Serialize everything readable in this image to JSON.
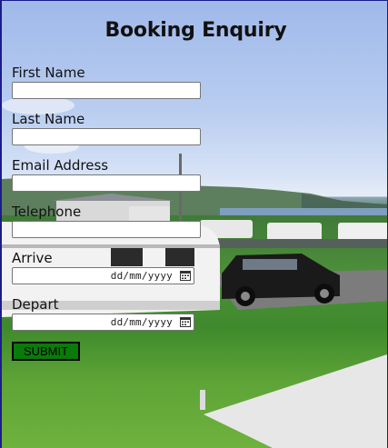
{
  "page": {
    "title": "Booking Enquiry"
  },
  "form": {
    "first_name": {
      "label": "First Name",
      "value": ""
    },
    "last_name": {
      "label": "Last Name",
      "value": ""
    },
    "email": {
      "label": "Email Address",
      "value": ""
    },
    "telephone": {
      "label": "Telephone",
      "value": ""
    },
    "arrive": {
      "label": "Arrive",
      "placeholder": "dd/mm/yyyy"
    },
    "depart": {
      "label": "Depart",
      "placeholder": "dd/mm/yyyy"
    },
    "submit_label": "SUBMIT"
  },
  "colors": {
    "submit_bg": "#0a7a0a",
    "border": "#1c1c8c"
  },
  "icons": {
    "date_picker": "calendar-icon"
  }
}
